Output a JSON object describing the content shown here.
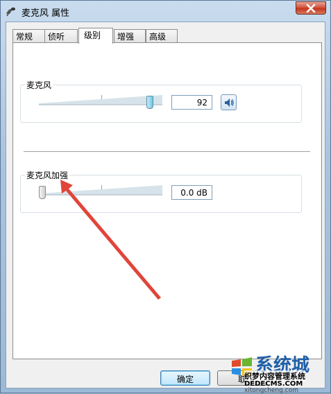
{
  "window": {
    "title": "麦克风 属性"
  },
  "tabs": [
    {
      "label": "常规"
    },
    {
      "label": "侦听"
    },
    {
      "label": "级别"
    },
    {
      "label": "增强"
    },
    {
      "label": "高级"
    }
  ],
  "active_tab": "级别",
  "microphone": {
    "label": "麦克风",
    "value": "92",
    "level": 92
  },
  "boost": {
    "label": "麦克风加强",
    "value": "0.0 dB",
    "level": 0
  },
  "buttons": {
    "ok": "确定",
    "cancel": "取"
  },
  "watermark": {
    "brand": "系统城",
    "line1": "织梦内容管理系统",
    "line2": "DEDECMS.COM",
    "line3": "xitongcheng.com"
  },
  "colors": {
    "accent": "#6fc6e3",
    "arrow": "#e0453a",
    "close": "#c4361f"
  }
}
